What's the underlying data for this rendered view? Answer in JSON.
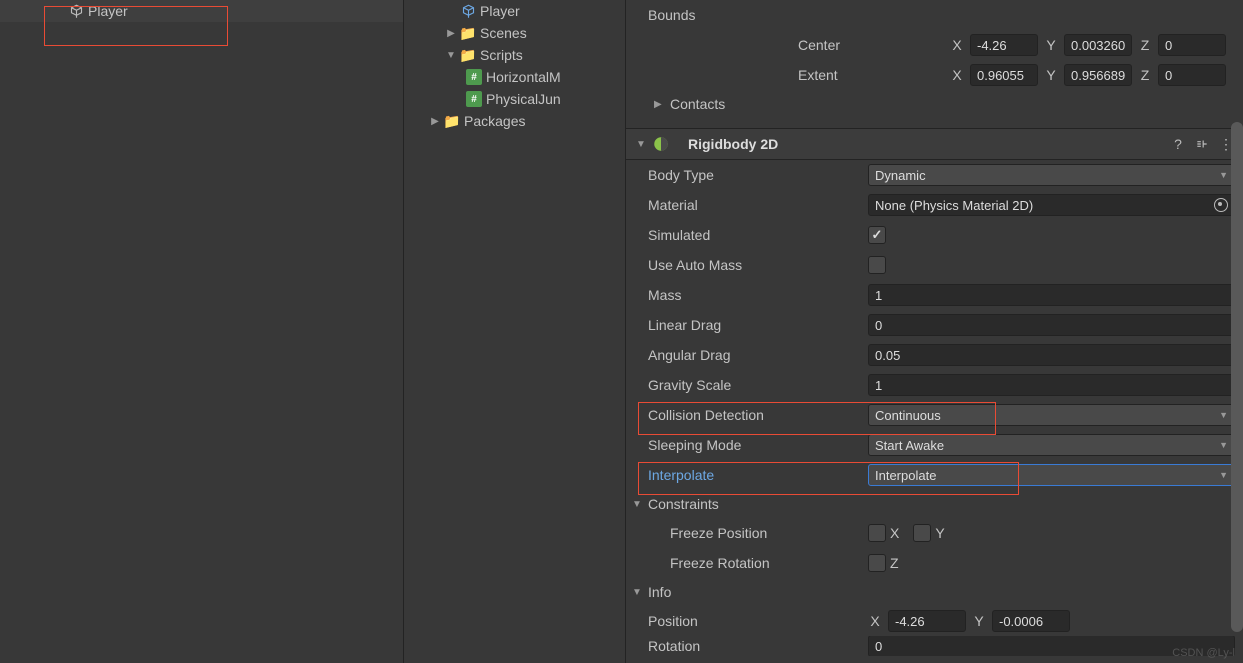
{
  "hierarchy": {
    "player": "Player"
  },
  "project": {
    "player_prefab": "Player",
    "scenes": "Scenes",
    "scripts": "Scripts",
    "script1": "HorizontalM",
    "script2": "PhysicalJun",
    "packages": "Packages"
  },
  "inspector": {
    "bounds": {
      "label": "Bounds",
      "center": {
        "label": "Center",
        "x": "-4.26",
        "y": "0.003260",
        "z": "0"
      },
      "extent": {
        "label": "Extent",
        "x": "0.96055",
        "y": "0.956689",
        "z": "0"
      }
    },
    "contacts": "Contacts",
    "rigidbody": {
      "title": "Rigidbody 2D",
      "body_type": {
        "label": "Body Type",
        "value": "Dynamic"
      },
      "material": {
        "label": "Material",
        "value": "None (Physics Material 2D)"
      },
      "simulated": {
        "label": "Simulated"
      },
      "use_auto_mass": {
        "label": "Use Auto Mass"
      },
      "mass": {
        "label": "Mass",
        "value": "1"
      },
      "linear_drag": {
        "label": "Linear Drag",
        "value": "0"
      },
      "angular_drag": {
        "label": "Angular Drag",
        "value": "0.05"
      },
      "gravity_scale": {
        "label": "Gravity Scale",
        "value": "1"
      },
      "collision_detection": {
        "label": "Collision Detection",
        "value": "Continuous"
      },
      "sleeping_mode": {
        "label": "Sleeping Mode",
        "value": "Start Awake"
      },
      "interpolate": {
        "label": "Interpolate",
        "value": "Interpolate"
      },
      "constraints": {
        "label": "Constraints",
        "freeze_position": {
          "label": "Freeze Position",
          "x": "X",
          "y": "Y"
        },
        "freeze_rotation": {
          "label": "Freeze Rotation",
          "z": "Z"
        }
      },
      "info": {
        "label": "Info",
        "position": {
          "label": "Position",
          "x": "-4.26",
          "y": "-0.0006"
        },
        "rotation": {
          "label": "Rotation",
          "value": "0"
        }
      }
    }
  },
  "axis": {
    "x": "X",
    "y": "Y",
    "z": "Z"
  },
  "watermark": "CSDN @Ly-l"
}
